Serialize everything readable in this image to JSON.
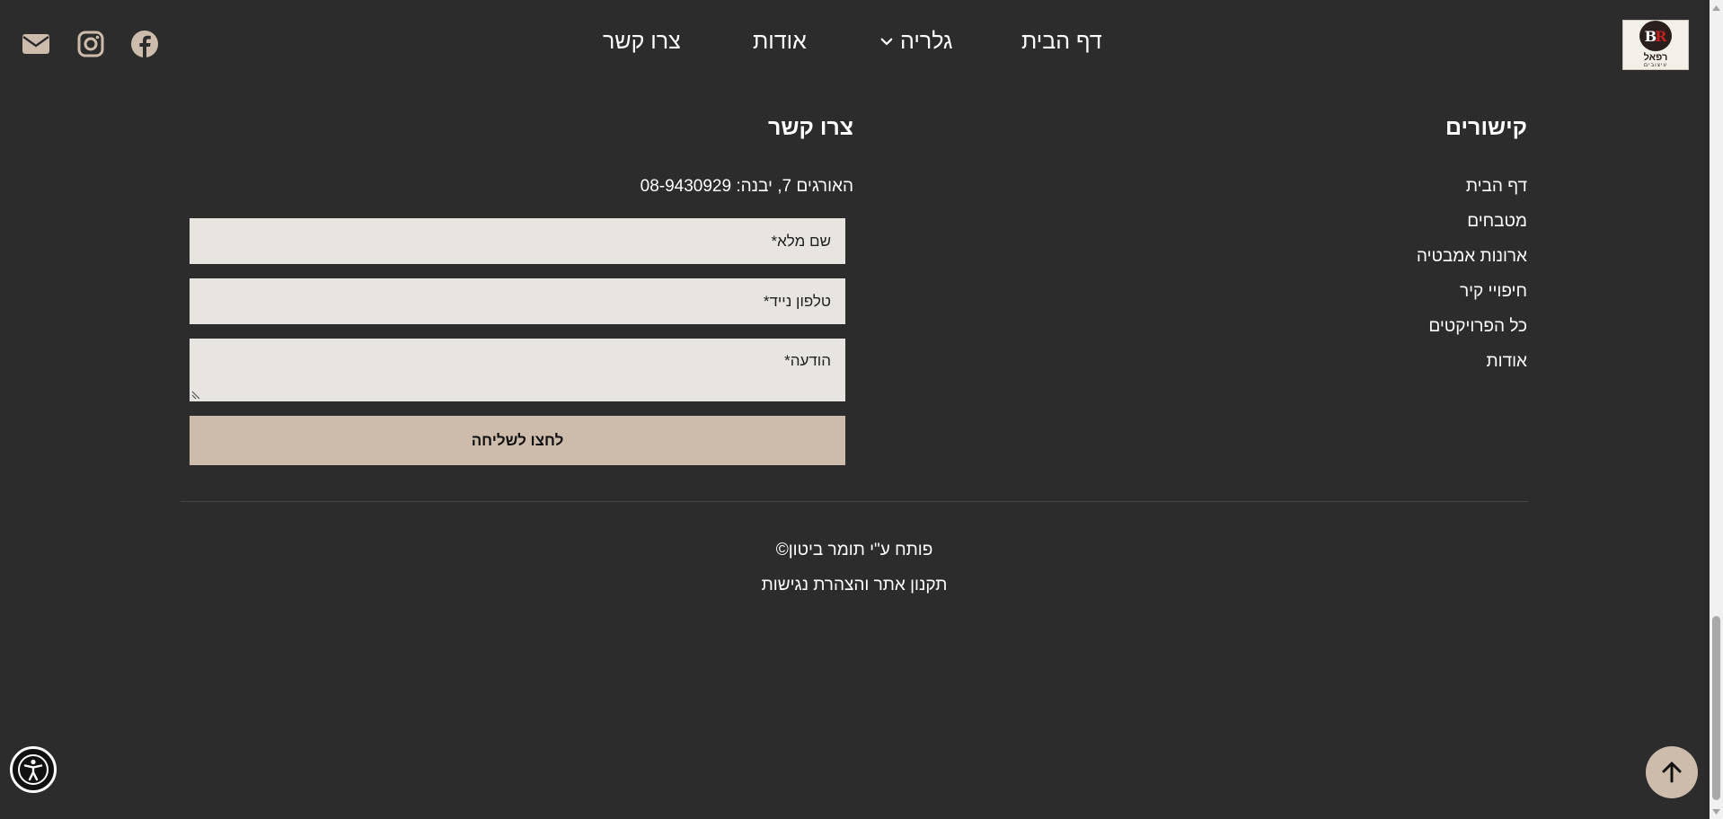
{
  "header": {
    "logo": {
      "text": "רפאל",
      "subtext": "עיצובים"
    },
    "nav": {
      "home": "דף הבית",
      "gallery": "גלריה",
      "about": "אודות",
      "contact": "צרו קשר"
    },
    "social_icons": [
      "facebook-icon",
      "instagram-icon",
      "mail-icon"
    ]
  },
  "links_section": {
    "title": "קישורים",
    "items": [
      "דף הבית",
      "מטבחים",
      "ארונות אמבטיה",
      "חיפויי קיר",
      "כל הפרויקטים",
      "אודות"
    ]
  },
  "contact_section": {
    "title": "צרו קשר",
    "address": "האורגים 7, יבנה: 08-9430929",
    "form": {
      "name_placeholder": "שם מלא*",
      "phone_placeholder": "טלפון נייד*",
      "message_placeholder": "הודעה*",
      "submit_label": "לחצו לשליחה"
    }
  },
  "footer": {
    "credit": "פותח ע\"י תומר ביטון©",
    "accessibility_link": "תקנון אתר והצהרת נגישות"
  },
  "colors": {
    "background": "#2c2c2c",
    "accent": "#cdbcab",
    "field_background": "#e8e4df",
    "text": "#ffffff"
  }
}
